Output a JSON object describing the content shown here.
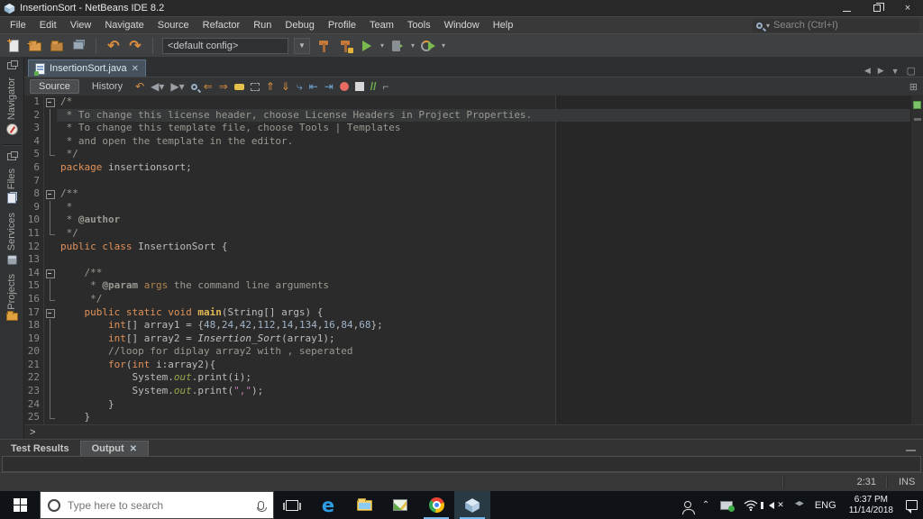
{
  "window": {
    "title": "InsertionSort - NetBeans IDE 8.2"
  },
  "menu": {
    "items": [
      "File",
      "Edit",
      "View",
      "Navigate",
      "Source",
      "Refactor",
      "Run",
      "Debug",
      "Profile",
      "Team",
      "Tools",
      "Window",
      "Help"
    ],
    "search_placeholder": "Search (Ctrl+I)"
  },
  "toolbar": {
    "config_value": "<default config>"
  },
  "sidebar": {
    "tabs": [
      {
        "label": "Navigator"
      },
      {
        "label": "Files"
      },
      {
        "label": "Services"
      },
      {
        "label": "Projects"
      }
    ]
  },
  "editor": {
    "tab_label": "InsertionSort.java",
    "source_label": "Source",
    "history_label": "History",
    "breadcrumb": ">",
    "lines": [
      {
        "n": "1",
        "f": "b",
        "s": [
          {
            "t": "/*",
            "c": "cm"
          }
        ]
      },
      {
        "n": "2",
        "f": "v",
        "hl": true,
        "s": [
          {
            "t": " * To change this license header, choose License Headers in Project Properties.",
            "c": "cm"
          }
        ]
      },
      {
        "n": "3",
        "f": "v",
        "s": [
          {
            "t": " * To change this template file, choose Tools | Templates",
            "c": "cm"
          }
        ]
      },
      {
        "n": "4",
        "f": "v",
        "s": [
          {
            "t": " * and open the template in the editor.",
            "c": "cm"
          }
        ]
      },
      {
        "n": "5",
        "f": "e",
        "s": [
          {
            "t": " */",
            "c": "cm"
          }
        ]
      },
      {
        "n": "6",
        "f": "",
        "s": [
          {
            "t": "package",
            "c": "kw"
          },
          {
            "t": " insertionsort;",
            "c": "pl"
          }
        ]
      },
      {
        "n": "7",
        "f": "",
        "s": []
      },
      {
        "n": "8",
        "f": "b",
        "s": [
          {
            "t": "/**",
            "c": "cm"
          }
        ]
      },
      {
        "n": "9",
        "f": "v",
        "s": [
          {
            "t": " *",
            "c": "cm"
          }
        ]
      },
      {
        "n": "10",
        "f": "v",
        "s": [
          {
            "t": " * ",
            "c": "cm"
          },
          {
            "t": "@author",
            "c": "tag"
          }
        ]
      },
      {
        "n": "11",
        "f": "e",
        "s": [
          {
            "t": " */",
            "c": "cm"
          }
        ]
      },
      {
        "n": "12",
        "f": "",
        "s": [
          {
            "t": "public class",
            "c": "kw"
          },
          {
            "t": " InsertionSort {",
            "c": "pl"
          }
        ]
      },
      {
        "n": "13",
        "f": "",
        "s": []
      },
      {
        "n": "14",
        "f": "b",
        "s": [
          {
            "t": "    ",
            "c": "pl"
          },
          {
            "t": "/**",
            "c": "cm"
          }
        ]
      },
      {
        "n": "15",
        "f": "v",
        "s": [
          {
            "t": "     ",
            "c": "pl"
          },
          {
            "t": "* ",
            "c": "cm"
          },
          {
            "t": "@param",
            "c": "tag"
          },
          {
            "t": " ",
            "c": "cm"
          },
          {
            "t": "args",
            "c": "ta"
          },
          {
            "t": " the command line arguments",
            "c": "cm"
          }
        ]
      },
      {
        "n": "16",
        "f": "e",
        "s": [
          {
            "t": "     ",
            "c": "pl"
          },
          {
            "t": "*/",
            "c": "cm"
          }
        ]
      },
      {
        "n": "17",
        "f": "b",
        "s": [
          {
            "t": "    ",
            "c": "pl"
          },
          {
            "t": "public static void",
            "c": "kw"
          },
          {
            "t": " ",
            "c": "pl"
          },
          {
            "t": "main",
            "c": "fn"
          },
          {
            "t": "(String[] args) {",
            "c": "pl"
          }
        ]
      },
      {
        "n": "18",
        "f": "v",
        "s": [
          {
            "t": "        ",
            "c": "pl"
          },
          {
            "t": "int",
            "c": "kw"
          },
          {
            "t": "[] array1 = {",
            "c": "pl"
          },
          {
            "t": "48",
            "c": "num"
          },
          {
            "t": ",",
            "c": "pl"
          },
          {
            "t": "24",
            "c": "num"
          },
          {
            "t": ",",
            "c": "pl"
          },
          {
            "t": "42",
            "c": "num"
          },
          {
            "t": ",",
            "c": "pl"
          },
          {
            "t": "112",
            "c": "num"
          },
          {
            "t": ",",
            "c": "pl"
          },
          {
            "t": "14",
            "c": "num"
          },
          {
            "t": ",",
            "c": "pl"
          },
          {
            "t": "134",
            "c": "num"
          },
          {
            "t": ",",
            "c": "pl"
          },
          {
            "t": "16",
            "c": "num"
          },
          {
            "t": ",",
            "c": "pl"
          },
          {
            "t": "84",
            "c": "num"
          },
          {
            "t": ",",
            "c": "pl"
          },
          {
            "t": "68",
            "c": "num"
          },
          {
            "t": "};",
            "c": "pl"
          }
        ]
      },
      {
        "n": "19",
        "f": "v",
        "s": [
          {
            "t": "        ",
            "c": "pl"
          },
          {
            "t": "int",
            "c": "kw"
          },
          {
            "t": "[] array2 = ",
            "c": "pl"
          },
          {
            "t": "Insertion_Sort",
            "c": "sm"
          },
          {
            "t": "(array1);",
            "c": "pl"
          }
        ]
      },
      {
        "n": "20",
        "f": "v",
        "s": [
          {
            "t": "        ",
            "c": "pl"
          },
          {
            "t": "//loop for diplay array2 with , seperated",
            "c": "cm"
          }
        ]
      },
      {
        "n": "21",
        "f": "v",
        "s": [
          {
            "t": "        ",
            "c": "pl"
          },
          {
            "t": "for",
            "c": "kw"
          },
          {
            "t": "(",
            "c": "pl"
          },
          {
            "t": "int",
            "c": "kw"
          },
          {
            "t": " i:array2){",
            "c": "pl"
          }
        ]
      },
      {
        "n": "22",
        "f": "v",
        "s": [
          {
            "t": "            System.",
            "c": "pl"
          },
          {
            "t": "out",
            "c": "sf"
          },
          {
            "t": ".print(i);",
            "c": "pl"
          }
        ]
      },
      {
        "n": "23",
        "f": "v",
        "s": [
          {
            "t": "            System.",
            "c": "pl"
          },
          {
            "t": "out",
            "c": "sf"
          },
          {
            "t": ".print(",
            "c": "pl"
          },
          {
            "t": "\",\"",
            "c": "str"
          },
          {
            "t": ");",
            "c": "pl"
          }
        ]
      },
      {
        "n": "24",
        "f": "v",
        "s": [
          {
            "t": "        }",
            "c": "pl"
          }
        ]
      },
      {
        "n": "25",
        "f": "e",
        "s": [
          {
            "t": "    }",
            "c": "pl"
          }
        ]
      }
    ]
  },
  "bottom_panel": {
    "tabs": [
      {
        "label": "Test Results"
      },
      {
        "label": "Output"
      }
    ]
  },
  "status_bar": {
    "caret_position": "2:31",
    "insert_mode": "INS"
  },
  "taskbar": {
    "search_placeholder": "Type here to search",
    "language": "ENG",
    "time": "6:37 PM",
    "date": "11/14/2018"
  }
}
